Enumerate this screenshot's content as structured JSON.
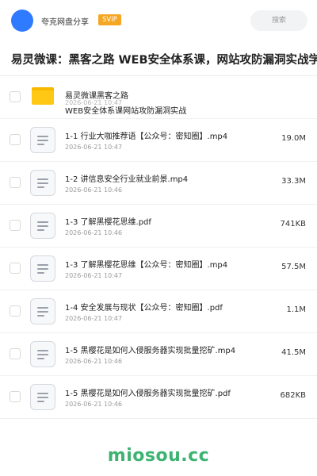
{
  "header": {
    "app_name": "夸克网盘分享",
    "svip": "SVIP",
    "search_placeholder": "搜索"
  },
  "page_title": "易灵微课：黑客之路 WEB安全体系课，网站攻防漏洞实战学",
  "folder": {
    "name_line1": "易灵微课黑客之路",
    "name_line2": "WEB安全体系课网站攻防漏洞实战",
    "date": "2026-06-21 10:47"
  },
  "files": [
    {
      "name": "1-1 行业大咖推荐语【公众号：密知圈】.mp4",
      "date": "2026-06-21 10:47",
      "size": "19.0M"
    },
    {
      "name": "1-2 讲信息安全行业就业前景.mp4",
      "date": "2026-06-21 10:46",
      "size": "33.3M"
    },
    {
      "name": "1-3 了解黑樱花思维.pdf",
      "date": "2026-06-21 10:46",
      "size": "741KB"
    },
    {
      "name": "1-3 了解黑樱花思维【公众号：密知圈】.mp4",
      "date": "2026-06-21 10:47",
      "size": "57.5M"
    },
    {
      "name": "1-4 安全发展与现状【公众号：密知圈】.pdf",
      "date": "2026-06-21 10:47",
      "size": "1.1M"
    },
    {
      "name": "1-5 黑樱花是如何入侵服务器实现批量挖矿.mp4",
      "date": "2026-06-21 10:46",
      "size": "41.5M"
    },
    {
      "name": "1-5 黑樱花是如何入侵服务器实现批量挖矿.pdf",
      "date": "2026-06-21 10:46",
      "size": "682KB"
    }
  ],
  "watermark": "miosou.cc"
}
